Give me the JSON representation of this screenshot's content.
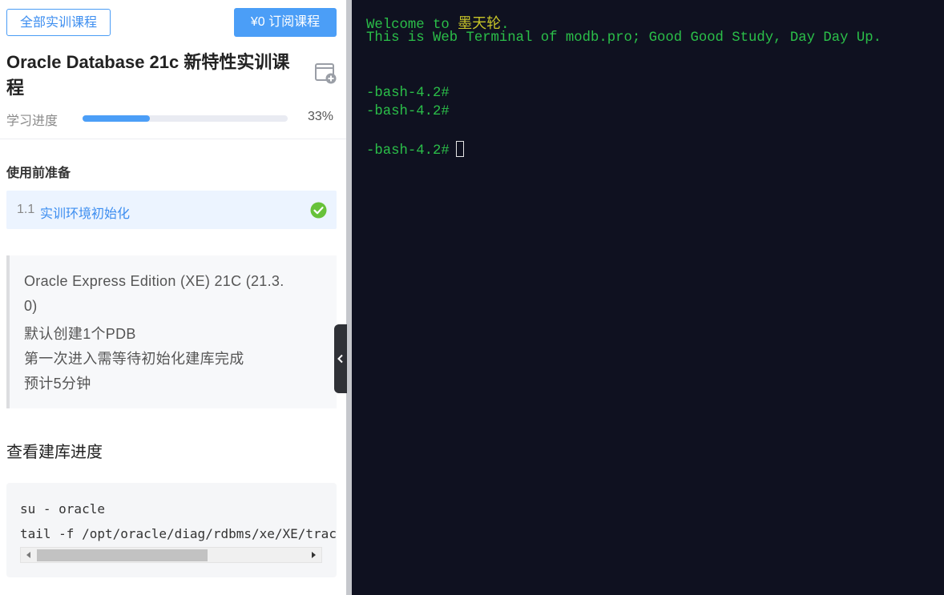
{
  "header": {
    "all_courses_label": "全部实训课程",
    "subscribe_label": "¥0 订阅课程"
  },
  "course": {
    "title": "Oracle Database 21c 新特性实训课程",
    "progress_label": "学习进度",
    "progress_value": 0.33,
    "progress_percent_text": "33%"
  },
  "section": {
    "title": "使用前准备",
    "lesson_number": "1.1",
    "lesson_name": "实训环境初始化",
    "lesson_completed": true
  },
  "note": {
    "lines": [
      "Oracle Express Edition (XE) 21C (21.3.",
      "0)",
      "默认创建1个PDB",
      "第一次进入需等待初始化建库完成",
      "预计5分钟"
    ]
  },
  "step": {
    "heading": "查看建库进度",
    "code_lines": [
      "su - oracle",
      "tail -f /opt/oracle/diag/rdbms/xe/XE/trace/alert_XE.log"
    ]
  },
  "terminal": {
    "welcome_prefix": "Welcome to ",
    "welcome_name": "墨天轮",
    "welcome_suffix": ".",
    "intro": "This is Web Terminal of modb.pro; Good Good Study, Day Day Up.",
    "prompts": [
      "-bash-4.2#",
      "-bash-4.2#",
      "-bash-4.2#"
    ]
  },
  "colors": {
    "accent": "#4b9ef7",
    "terminal_bg": "#0f1120",
    "terminal_text": "#2bbf49",
    "success": "#67c23a"
  }
}
